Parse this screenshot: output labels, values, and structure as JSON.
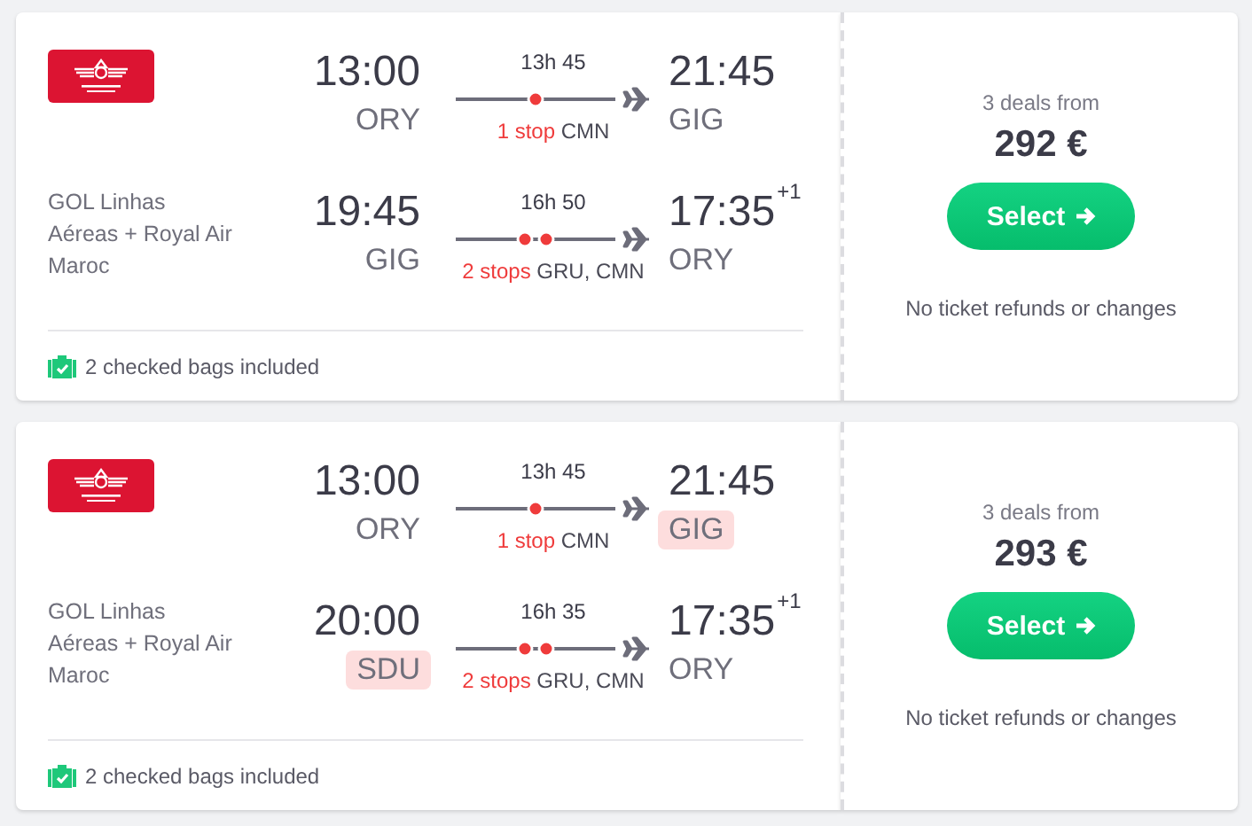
{
  "results": [
    {
      "legs": [
        {
          "carrier": {
            "kind": "logo"
          },
          "dep_time": "13:00",
          "dep_airport": "ORY",
          "dep_highlight": false,
          "duration": "13h 45",
          "stops_label": "1 stop",
          "stop_airports": "CMN",
          "arr_time": "21:45",
          "arr_airport": "GIG",
          "arr_highlight": false
        },
        {
          "carrier": {
            "kind": "text",
            "name": "GOL Linhas Aéreas + Royal Air Maroc"
          },
          "dep_time": "19:45",
          "dep_airport": "GIG",
          "dep_highlight": false,
          "duration": "16h 50",
          "stops_label": "2 stops",
          "stop_airports": "GRU, CMN",
          "arr_time": "17:35",
          "arr_day_offset": "+1",
          "arr_airport": "ORY",
          "arr_highlight": false
        }
      ],
      "bags": "2 checked bags included",
      "deals": "3 deals from",
      "price": "292 €",
      "button": "Select",
      "note": "No ticket refunds or changes"
    },
    {
      "legs": [
        {
          "carrier": {
            "kind": "logo"
          },
          "dep_time": "13:00",
          "dep_airport": "ORY",
          "dep_highlight": false,
          "duration": "13h 45",
          "stops_label": "1 stop",
          "stop_airports": "CMN",
          "arr_time": "21:45",
          "arr_airport": "GIG",
          "arr_highlight": true
        },
        {
          "carrier": {
            "kind": "text",
            "name": "GOL Linhas Aéreas + Royal Air Maroc"
          },
          "dep_time": "20:00",
          "dep_airport": "SDU",
          "dep_highlight": true,
          "duration": "16h 35",
          "stops_label": "2 stops",
          "stop_airports": "GRU, CMN",
          "arr_time": "17:35",
          "arr_day_offset": "+1",
          "arr_airport": "ORY",
          "arr_highlight": false
        }
      ],
      "bags": "2 checked bags included",
      "deals": "3 deals from",
      "price": "293 €",
      "button": "Select",
      "note": "No ticket refunds or changes"
    }
  ]
}
